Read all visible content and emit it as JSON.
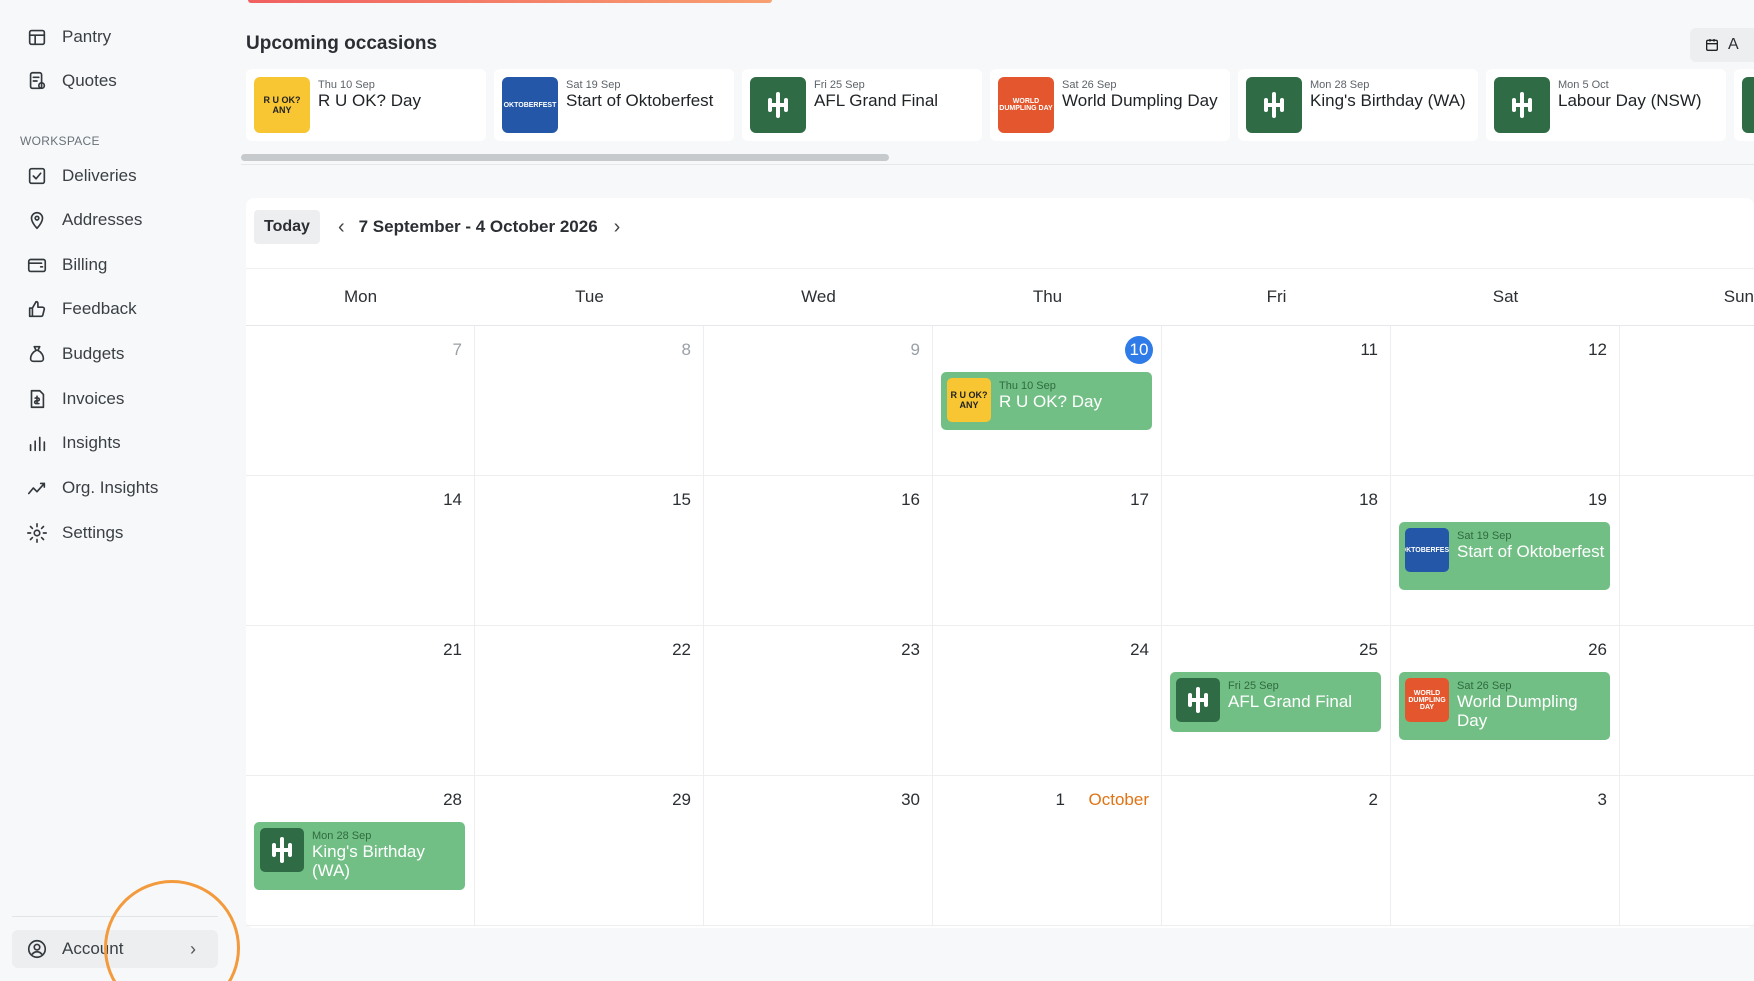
{
  "sidebar": {
    "items_top": [
      {
        "label": "Pantry",
        "icon": "pantry-icon"
      },
      {
        "label": "Quotes",
        "icon": "quotes-icon"
      }
    ],
    "section_label": "WORKSPACE",
    "items": [
      {
        "label": "Deliveries",
        "icon": "checkbox-icon"
      },
      {
        "label": "Addresses",
        "icon": "map-pin-icon"
      },
      {
        "label": "Billing",
        "icon": "wallet-icon"
      },
      {
        "label": "Feedback",
        "icon": "thumbs-up-icon"
      },
      {
        "label": "Budgets",
        "icon": "money-bag-icon"
      },
      {
        "label": "Invoices",
        "icon": "invoice-icon"
      },
      {
        "label": "Insights",
        "icon": "bar-chart-icon"
      },
      {
        "label": "Org. Insights",
        "icon": "trend-icon"
      },
      {
        "label": "Settings",
        "icon": "gear-icon"
      }
    ],
    "account_label": "Account"
  },
  "occasions": {
    "title": "Upcoming occasions",
    "top_right_label": "A",
    "cards": [
      {
        "date": "Thu 10 Sep",
        "name": "R U OK? Day",
        "thumb": "ruok"
      },
      {
        "date": "Sat 19 Sep",
        "name": "Start of Oktoberfest",
        "thumb": "okt"
      },
      {
        "date": "Fri 25 Sep",
        "name": "AFL Grand Final",
        "thumb": "logo"
      },
      {
        "date": "Sat 26 Sep",
        "name": "World Dumpling Day",
        "thumb": "dump"
      },
      {
        "date": "Mon 28 Sep",
        "name": "King's Birthday (WA)",
        "thumb": "logo"
      },
      {
        "date": "Mon 5 Oct",
        "name": "Labour Day (NSW)",
        "thumb": "logo"
      }
    ]
  },
  "calendar": {
    "today_label": "Today",
    "range": "7 September - 4 October 2026",
    "days": [
      "Mon",
      "Tue",
      "Wed",
      "Thu",
      "Fri",
      "Sat",
      "Sun"
    ],
    "weeks": [
      [
        "7",
        "8",
        "9",
        "10",
        "11",
        "12",
        ""
      ],
      [
        "14",
        "15",
        "16",
        "17",
        "18",
        "19",
        ""
      ],
      [
        "21",
        "22",
        "23",
        "24",
        "25",
        "26",
        ""
      ],
      [
        "28",
        "29",
        "30",
        "1",
        "2",
        "3",
        ""
      ]
    ],
    "october_word": "October",
    "events": [
      {
        "date": "Thu 10 Sep",
        "name": "R U OK? Day",
        "thumb": "ruok"
      },
      {
        "date": "Sat 19 Sep",
        "name": "Start of Oktoberfest",
        "thumb": "okt"
      },
      {
        "date": "Fri 25 Sep",
        "name": "AFL Grand Final",
        "thumb": "logo"
      },
      {
        "date": "Sat 26 Sep",
        "name": "World Dumpling Day",
        "thumb": "dump"
      },
      {
        "date": "Mon 28 Sep",
        "name": "King's Birthday (WA)",
        "thumb": "logo"
      }
    ],
    "thumb_text": {
      "ruok": "R U OK? ANY",
      "okt": "OKTOBERFEST",
      "dump": "WORLD DUMPLING DAY"
    }
  }
}
